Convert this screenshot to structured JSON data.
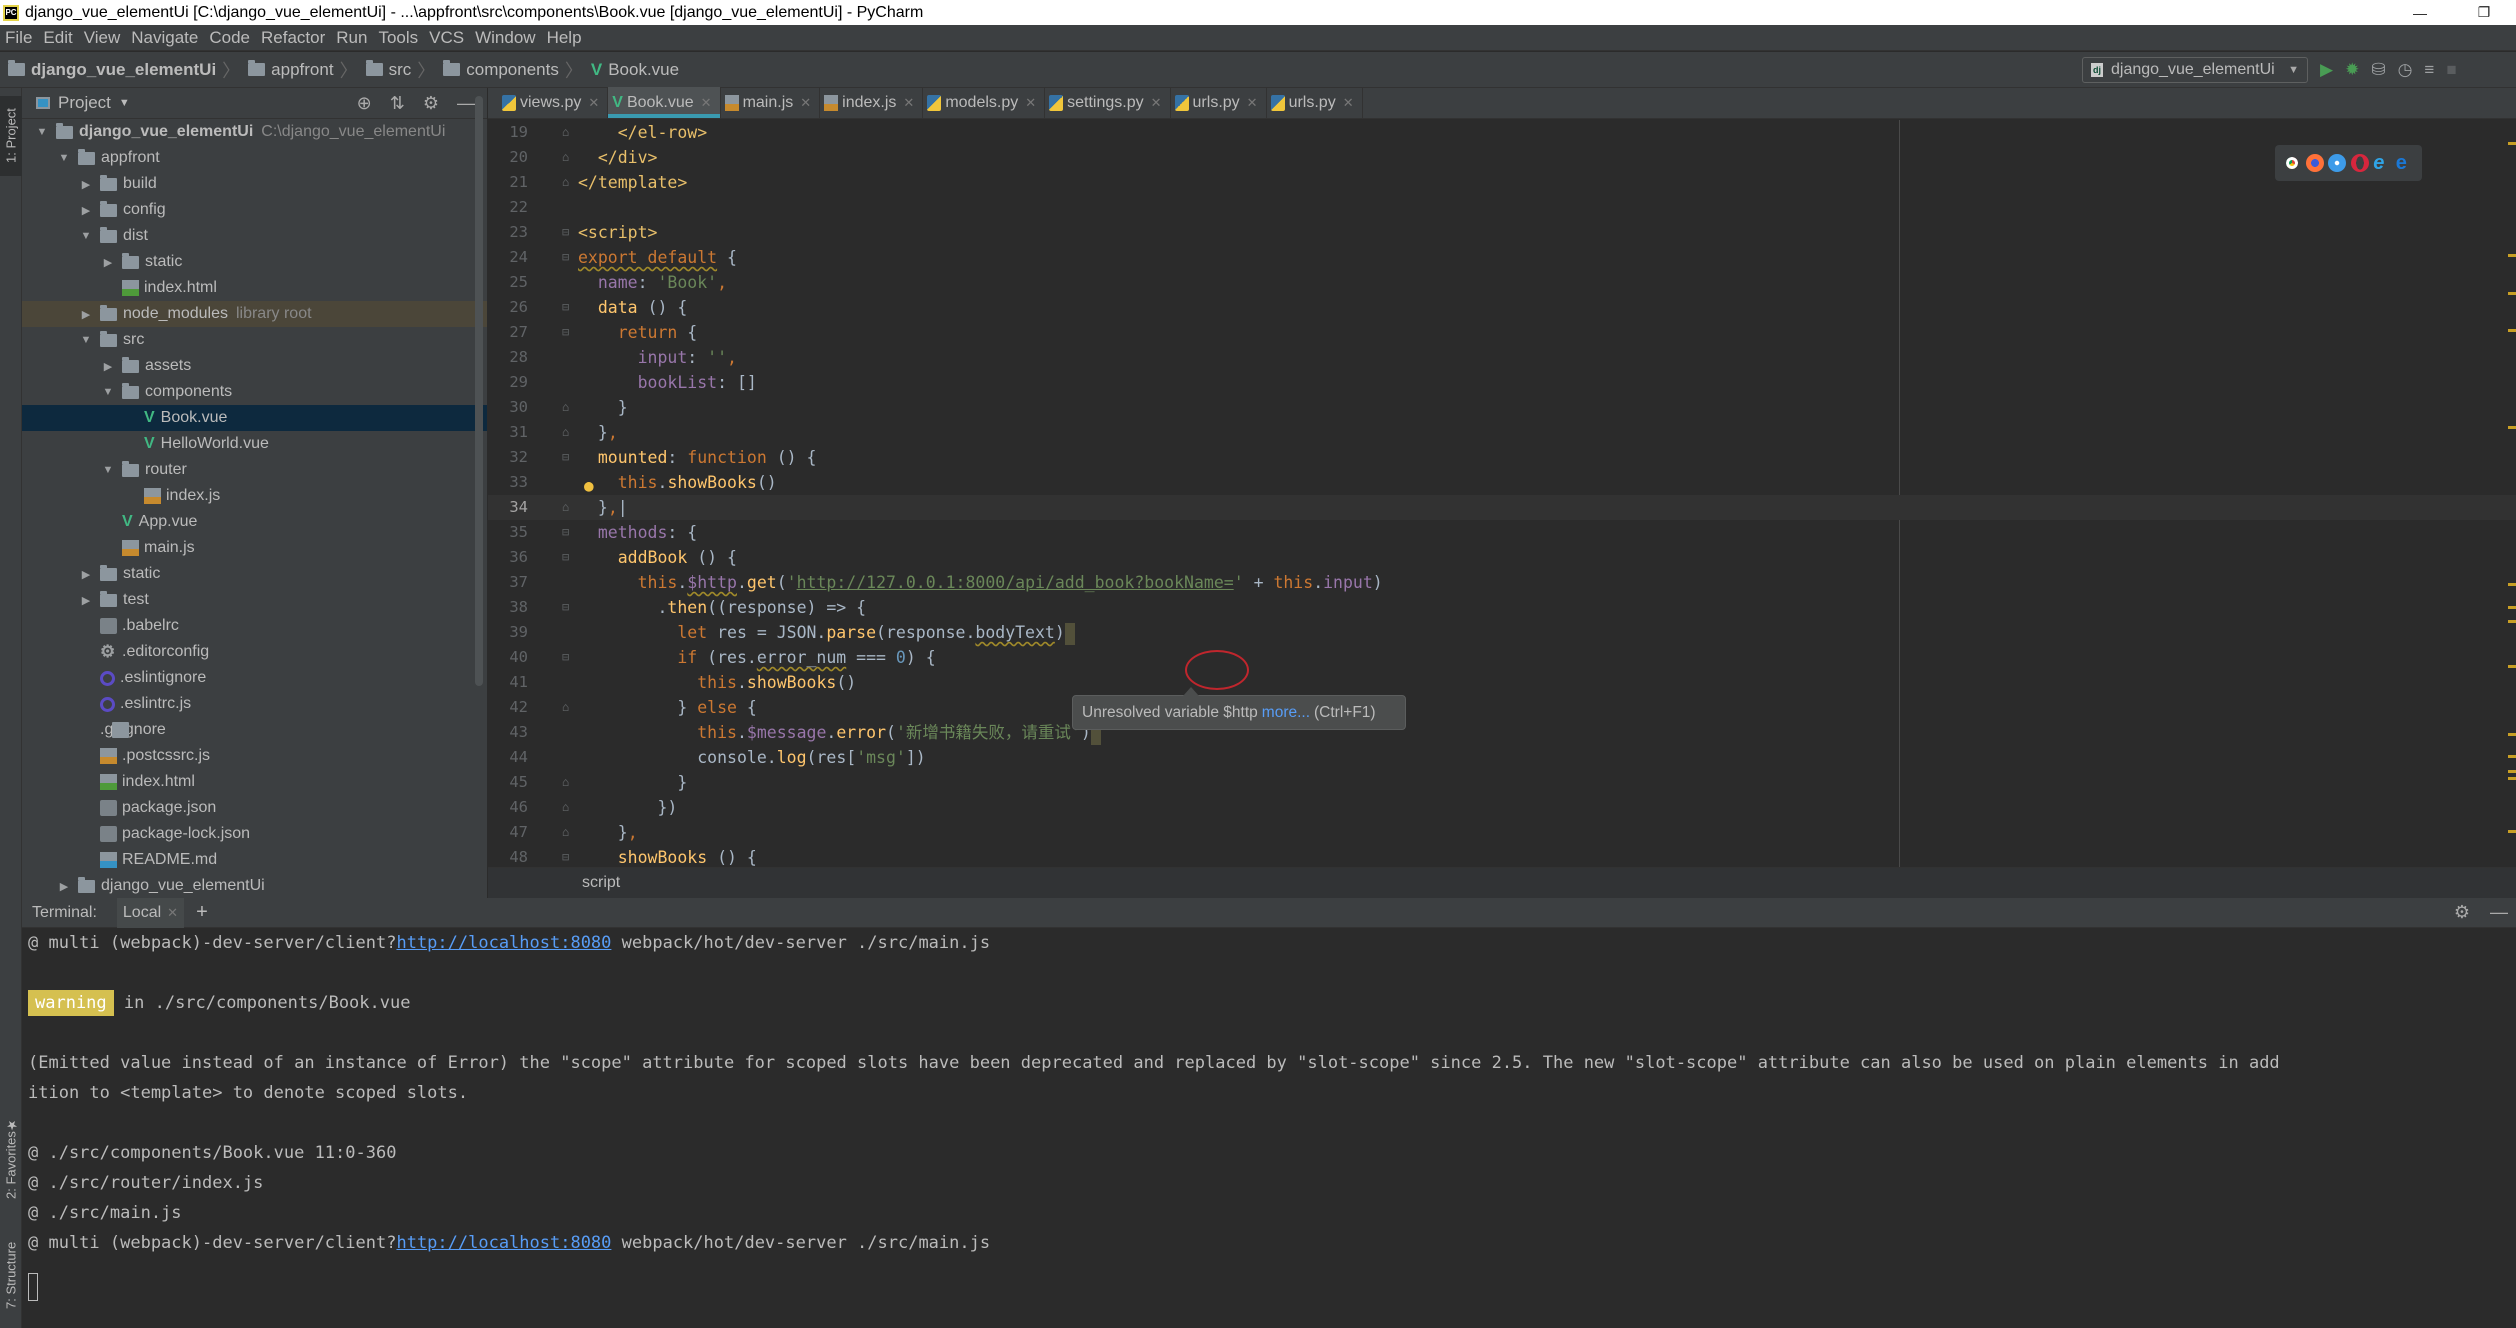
{
  "window": {
    "title": "django_vue_elementUi [C:\\django_vue_elementUi] - ...\\appfront\\src\\components\\Book.vue [django_vue_elementUi] - PyCharm",
    "minimize_icon": "minimize-icon",
    "restore_icon": "restore-icon"
  },
  "menu": [
    "File",
    "Edit",
    "View",
    "Navigate",
    "Code",
    "Refactor",
    "Run",
    "Tools",
    "VCS",
    "Window",
    "Help"
  ],
  "breadcrumb": [
    "django_vue_elementUi",
    "appfront",
    "src",
    "components",
    "Book.vue"
  ],
  "run_config": {
    "label": "django_vue_elementUi",
    "icons": [
      "run-icon",
      "debug-icon",
      "coverage-icon",
      "profile-icon",
      "concurrency-icon",
      "stop-icon"
    ]
  },
  "side_tabs": {
    "project": "1: Project",
    "favorites": "2: Favorites",
    "structure": "7: Structure"
  },
  "project": {
    "title": "Project",
    "tree": [
      {
        "name": "django_vue_elementUi",
        "hint": "C:\\django_vue_elementUi",
        "type": "folder",
        "depth": 0,
        "expanded": true,
        "bold": true
      },
      {
        "name": "appfront",
        "type": "folder",
        "depth": 1,
        "expanded": true
      },
      {
        "name": "build",
        "type": "folder",
        "depth": 2,
        "expanded": false
      },
      {
        "name": "config",
        "type": "folder",
        "depth": 2,
        "expanded": false
      },
      {
        "name": "dist",
        "type": "folder",
        "depth": 2,
        "expanded": true
      },
      {
        "name": "static",
        "type": "folder",
        "depth": 3,
        "expanded": false
      },
      {
        "name": "index.html",
        "type": "html",
        "depth": 3
      },
      {
        "name": "node_modules",
        "hint": "library root",
        "type": "folder",
        "depth": 2,
        "expanded": false,
        "library": true
      },
      {
        "name": "src",
        "type": "folder",
        "depth": 2,
        "expanded": true
      },
      {
        "name": "assets",
        "type": "folder",
        "depth": 3,
        "expanded": false
      },
      {
        "name": "components",
        "type": "folder",
        "depth": 3,
        "expanded": true
      },
      {
        "name": "Book.vue",
        "type": "vue",
        "depth": 4,
        "selected": true
      },
      {
        "name": "HelloWorld.vue",
        "type": "vue",
        "depth": 4
      },
      {
        "name": "router",
        "type": "folder",
        "depth": 3,
        "expanded": true
      },
      {
        "name": "index.js",
        "type": "js",
        "depth": 4
      },
      {
        "name": "App.vue",
        "type": "vue",
        "depth": 3
      },
      {
        "name": "main.js",
        "type": "js",
        "depth": 3
      },
      {
        "name": "static",
        "type": "folder",
        "depth": 2,
        "expanded": false
      },
      {
        "name": "test",
        "type": "folder",
        "depth": 2,
        "expanded": false
      },
      {
        "name": ".babelrc",
        "type": "json",
        "depth": 2
      },
      {
        "name": ".editorconfig",
        "type": "gear",
        "depth": 2
      },
      {
        "name": ".eslintignore",
        "type": "eslint",
        "depth": 2
      },
      {
        "name": ".eslintrc.js",
        "type": "eslint",
        "depth": 2
      },
      {
        "name": ".gitignore",
        "type": "txt",
        "depth": 2
      },
      {
        "name": ".postcssrc.js",
        "type": "js",
        "depth": 2
      },
      {
        "name": "index.html",
        "type": "html",
        "depth": 2
      },
      {
        "name": "package.json",
        "type": "json",
        "depth": 2
      },
      {
        "name": "package-lock.json",
        "type": "json",
        "depth": 2
      },
      {
        "name": "README.md",
        "type": "md",
        "depth": 2
      },
      {
        "name": "django_vue_elementUi",
        "type": "folder",
        "depth": 1,
        "expanded": false
      }
    ]
  },
  "tabs": [
    {
      "label": "views.py",
      "type": "py"
    },
    {
      "label": "Book.vue",
      "type": "vue",
      "active": true
    },
    {
      "label": "main.js",
      "type": "js"
    },
    {
      "label": "index.js",
      "type": "js"
    },
    {
      "label": "models.py",
      "type": "py"
    },
    {
      "label": "settings.py",
      "type": "py"
    },
    {
      "label": "urls.py",
      "type": "py"
    },
    {
      "label": "urls.py",
      "type": "py"
    }
  ],
  "code": {
    "lines": [
      {
        "n": "19",
        "html": "    <span class='tg'>&lt;/el-row&gt;</span>"
      },
      {
        "n": "20",
        "html": "  <span class='tg'>&lt;/div&gt;</span>"
      },
      {
        "n": "21",
        "html": "<span class='tg'>&lt;/template&gt;</span>"
      },
      {
        "n": "22",
        "html": ""
      },
      {
        "n": "23",
        "html": "<span class='tg'>&lt;script&gt;</span>"
      },
      {
        "n": "24",
        "html": "<span class='kw und'>export default</span> <span class='pl'>{</span>"
      },
      {
        "n": "25",
        "html": "  <span class='pr'>name</span><span class='pl'>: </span><span class='st'>'Book'</span><span class='kw'>,</span>"
      },
      {
        "n": "26",
        "html": "  <span class='fn'>data</span> <span class='pl'>() {</span>"
      },
      {
        "n": "27",
        "html": "    <span class='kw'>return</span> <span class='pl'>{</span>"
      },
      {
        "n": "28",
        "html": "      <span class='pr'>input</span><span class='pl'>: </span><span class='st'>''</span><span class='kw'>,</span>"
      },
      {
        "n": "29",
        "html": "      <span class='pr'>bookList</span><span class='pl'>: []</span>"
      },
      {
        "n": "30",
        "html": "    <span class='pl'>}</span>"
      },
      {
        "n": "31",
        "html": "  <span class='pl'>}</span><span class='kw'>,</span>"
      },
      {
        "n": "32",
        "html": "  <span class='fn'>mounted</span><span class='pl'>: </span><span class='kw'>function</span> <span class='pl'>() {</span>"
      },
      {
        "n": "33",
        "html": "    <span class='kw'>this</span><span class='pl'>.</span><span class='fn'>showBooks</span><span class='pl'>()</span>",
        "bulb": true
      },
      {
        "n": "34",
        "html": "  <span class='pl'>}</span><span class='kw'>,</span><span class='pl'>|</span>",
        "current": true
      },
      {
        "n": "35",
        "html": "  <span class='pr'>methods</span><span class='pl'>: {</span>"
      },
      {
        "n": "36",
        "html": "    <span class='fn'>addBook</span> <span class='pl'>() {</span>"
      },
      {
        "n": "37",
        "html": "      <span class='kw'>this</span><span class='pl'>.</span><span class='pr und'>$http</span><span class='pl'>.</span><span class='fn'>get</span><span class='pl'>(</span><span class='st'>'<span class=\"url\">http://127.0.0.1:8000/api/add_book?bookName=</span>'</span> <span class='pl'>+ </span><span class='kw'>this</span><span class='pl'>.</span><span class='pr'>input</span><span class='pl'>)</span>"
      },
      {
        "n": "38",
        "html": "        <span class='pl'>.</span><span class='fn'>then</span><span class='pl'>((response) =&gt; {</span>"
      },
      {
        "n": "39",
        "html": "          <span class='kw'>let</span> <span class='pl'>res = JSON.</span><span class='fn'>parse</span><span class='pl'>(response.</span><span class='pl und'>bodyText</span><span class='pl'>)</span><span class='endmark'></span>"
      },
      {
        "n": "40",
        "html": "          <span class='kw'>if</span> <span class='pl'>(res.</span><span class='pl und'>error_num</span> <span class='pl'>=== </span><span class='nu'>0</span><span class='pl'>) {</span>"
      },
      {
        "n": "41",
        "html": "            <span class='kw'>this</span><span class='pl'>.</span><span class='fn'>showBooks</span><span class='pl'>()</span>"
      },
      {
        "n": "42",
        "html": "          <span class='pl'>} </span><span class='kw'>else</span> <span class='pl'>{</span>"
      },
      {
        "n": "43",
        "html": "            <span class='kw'>this</span><span class='pl'>.</span><span class='pr'>$message</span><span class='pl'>.</span><span class='fn'>error</span><span class='pl'>(</span><span class='st'>'新增书籍失败，请重试'</span><span class='pl'>)</span><span class='endmark'></span>"
      },
      {
        "n": "44",
        "html": "            <span class='pl'>console.</span><span class='fn'>log</span><span class='pl'>(res[</span><span class='st'>'msg'</span><span class='pl'>])</span>"
      },
      {
        "n": "45",
        "html": "          <span class='pl'>}</span>"
      },
      {
        "n": "46",
        "html": "        <span class='pl'>})</span>"
      },
      {
        "n": "47",
        "html": "    <span class='pl'>}</span><span class='kw'>,</span>"
      },
      {
        "n": "48",
        "html": "    <span class='fn'>showBooks</span> <span class='pl'>() {</span>"
      }
    ],
    "context_breadcrumb": "script"
  },
  "tooltip": {
    "text": "Unresolved variable $http",
    "link": "more...",
    "shortcut": "(Ctrl+F1)"
  },
  "browser_icons": [
    "chrome-icon",
    "firefox-icon",
    "safari-icon",
    "opera-icon",
    "ie-icon",
    "edge-icon"
  ],
  "terminal": {
    "label": "Terminal:",
    "tab": "Local",
    "lines": [
      {
        "pre": "@ multi (webpack)-dev-server/client?",
        "link": "http://localhost:8080",
        "post": " webpack/hot/dev-server ./src/main.js"
      },
      {
        "pre": ""
      },
      {
        "badge": "warning",
        "pre": " in ./src/components/Book.vue"
      },
      {
        "pre": ""
      },
      {
        "pre": "(Emitted value instead of an instance of Error) the \"scope\" attribute for scoped slots have been deprecated and replaced by \"slot-scope\" since 2.5. The new \"slot-scope\" attribute can also be used on plain elements in add"
      },
      {
        "pre": "ition to <template> to denote scoped slots."
      },
      {
        "pre": ""
      },
      {
        "pre": "@ ./src/components/Book.vue 11:0-360"
      },
      {
        "pre": "@ ./src/router/index.js"
      },
      {
        "pre": "@ ./src/main.js"
      },
      {
        "pre": "@ multi (webpack)-dev-server/client?",
        "link": "http://localhost:8080",
        "post": " webpack/hot/dev-server ./src/main.js"
      }
    ]
  }
}
